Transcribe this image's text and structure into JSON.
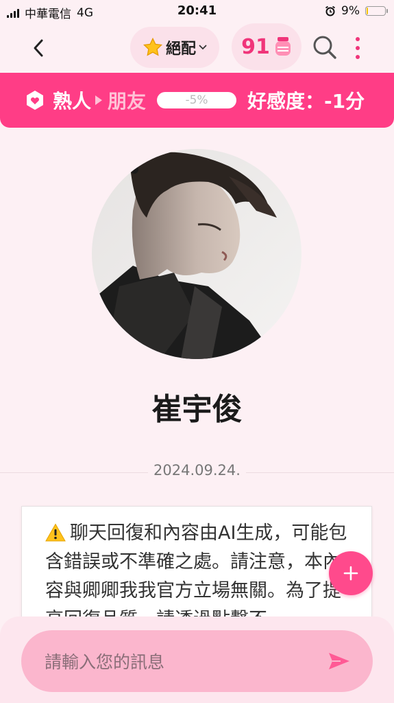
{
  "status_bar": {
    "carrier": "中華電信",
    "network": "4G",
    "time": "20:41",
    "battery_percent": "9%",
    "battery_level": 0.09
  },
  "header": {
    "match_label": "絕配",
    "points": "91"
  },
  "relationship": {
    "current_level": "熟人",
    "next_level": "朋友",
    "progress_text": "-5%",
    "affinity": "好感度：-1分"
  },
  "profile": {
    "name": "崔宇俊"
  },
  "chat": {
    "date": "2024.09.24.",
    "notice_text": "聊天回復和內容由AI生成，可能包含錯誤或不準確之處。請注意，本內容與卿卿我我官方立場無關。為了提高回復品質，請透過點擊不"
  },
  "composer": {
    "placeholder": "請輸入您的訊息"
  },
  "colors": {
    "accent": "#ff3d86",
    "background": "#fdf0f4",
    "pill": "#fbe1ea",
    "input": "#fbb6cd"
  }
}
